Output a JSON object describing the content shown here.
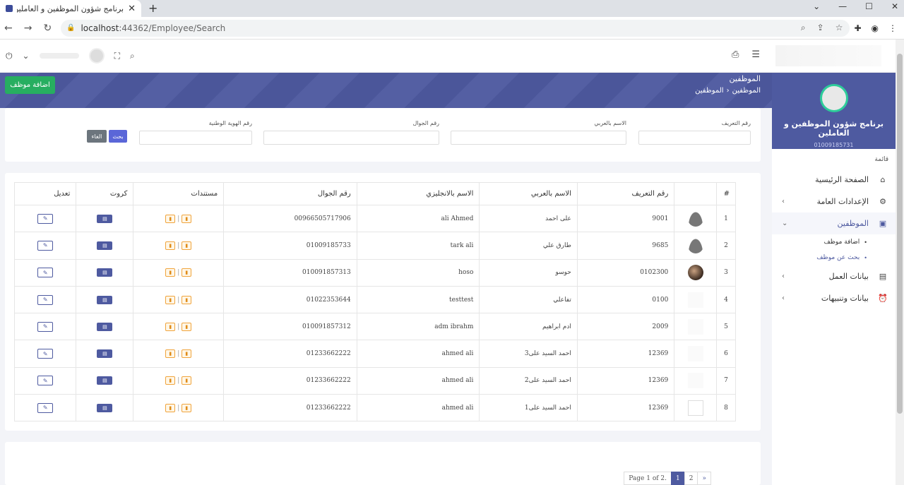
{
  "browser": {
    "tab_title": "برنامج شؤون الموظفين و العاملين",
    "url_host": "localhost",
    "url_rest": ":44362/Employee/Search"
  },
  "sidebar": {
    "app_title": "برنامج شؤون الموظفين و العاملين",
    "phone": "01009185731",
    "list_label": "قائمة",
    "menu": [
      {
        "label": "الصفحة الرئيسية",
        "icon": "home-icon"
      },
      {
        "label": "الإعدادات العامة",
        "icon": "gear-icon"
      },
      {
        "label": "الموظفين",
        "icon": "user-badge-icon"
      },
      {
        "label": "بيانات العمل",
        "icon": "id-card-icon"
      },
      {
        "label": "بيانات وتنبيهات",
        "icon": "alarm-icon"
      }
    ],
    "submenu": [
      {
        "label": "اضافة موظف"
      },
      {
        "label": "بحث عن موظف"
      }
    ]
  },
  "header": {
    "page_title": "الموظفين",
    "breadcrumb": [
      "الموظفين",
      "الموظفين"
    ],
    "add_button": "اضافة موظف"
  },
  "search": {
    "fields": [
      {
        "label": "رقم التعريف",
        "value": ""
      },
      {
        "label": "الاسم بالعربي",
        "value": ""
      },
      {
        "label": "رقم الجوال",
        "value": ""
      },
      {
        "label": "رقم الهوية الوطنية",
        "value": ""
      }
    ],
    "search_button": "بحث",
    "cancel_button": "الغاء"
  },
  "table": {
    "headers": [
      "#",
      "",
      "رقم التعريف",
      "الاسم بالعربي",
      "الاسم بالانجليزي",
      "رقم الجوال",
      "مستندات",
      "كروت",
      "تعديل"
    ],
    "rows": [
      {
        "n": "1",
        "photo": "person",
        "code": "9001",
        "ar": "على احمد",
        "en": "ali Ahmed",
        "mobile": "00966505717906"
      },
      {
        "n": "2",
        "photo": "person",
        "code": "9685",
        "ar": "طارق علي",
        "en": "tark ali",
        "mobile": "01009185733"
      },
      {
        "n": "3",
        "photo": "photo",
        "code": "0102300",
        "ar": "حوسو",
        "en": "hoso",
        "mobile": "010091857313"
      },
      {
        "n": "4",
        "photo": "blank",
        "code": "0100",
        "ar": "تفاعلي",
        "en": "testtest",
        "mobile": "01022353644"
      },
      {
        "n": "5",
        "photo": "blank",
        "code": "2009",
        "ar": "ادم ابراهيم",
        "en": "adm ibrahm",
        "mobile": "010091857312"
      },
      {
        "n": "6",
        "photo": "blank",
        "code": "12369",
        "ar": "احمد السيد على3",
        "en": "ahmed ali",
        "mobile": "01233662222"
      },
      {
        "n": "7",
        "photo": "blank",
        "code": "12369",
        "ar": "احمد السيد على2",
        "en": "ahmed ali",
        "mobile": "01233662222"
      },
      {
        "n": "8",
        "photo": "broken",
        "code": "12369",
        "ar": "احمد السيد على1",
        "en": "ahmed ali",
        "mobile": "01233662222"
      }
    ]
  },
  "pagination": {
    "summary": "Page 1 of 2.",
    "pages": [
      "1",
      "2"
    ],
    "next": "»"
  },
  "colors": {
    "primary": "#4e5aa0",
    "success": "#27ae60",
    "warning": "#f0a43c"
  }
}
